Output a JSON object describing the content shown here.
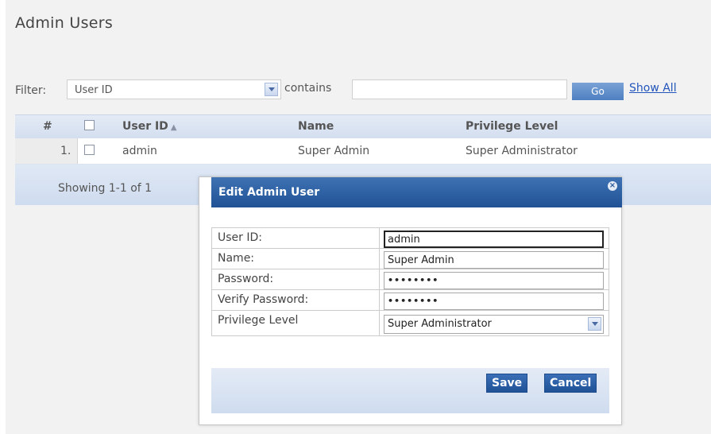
{
  "page": {
    "title": "Admin Users"
  },
  "filter": {
    "label": "Filter:",
    "field_selected": "User ID",
    "operator_label": "contains",
    "value": "",
    "go_label": "Go",
    "show_all_label": "Show All"
  },
  "table": {
    "columns": [
      "#",
      "User ID",
      "Name",
      "Privilege Level"
    ],
    "sort_indicator": "▲",
    "rows": [
      {
        "num": "1.",
        "user_id": "admin",
        "name": "Super Admin",
        "privilege": "Super Administrator"
      }
    ],
    "footer": "Showing 1-1 of 1"
  },
  "modal": {
    "title": "Edit Admin User",
    "close_glyph": "×",
    "fields": {
      "user_id": {
        "label": "User ID:",
        "value": "admin"
      },
      "name": {
        "label": "Name:",
        "value": "Super Admin"
      },
      "password": {
        "label": "Password:",
        "value": "••••••••"
      },
      "verify": {
        "label": "Verify Password:",
        "value": "••••••••"
      },
      "privilege": {
        "label": "Privilege Level",
        "value": "Super Administrator"
      }
    },
    "save_label": "Save",
    "cancel_label": "Cancel"
  },
  "colors": {
    "modal_header": "#2a5ea3",
    "link": "#2255bb",
    "button": "#2b61a8"
  }
}
